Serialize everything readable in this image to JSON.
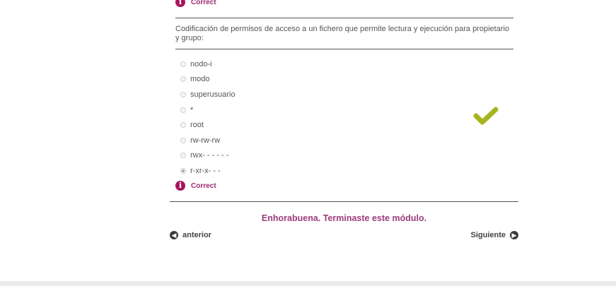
{
  "top_feedback": {
    "icon": "info-icon",
    "label": "Correct"
  },
  "question": {
    "text": "Codificación de permisos de acceso a un fichero que permite lectura y ejecución para propietario y grupo:",
    "options": [
      {
        "label": "nodo-i",
        "selected": false
      },
      {
        "label": "modo",
        "selected": false
      },
      {
        "label": "superusuario",
        "selected": false
      },
      {
        "label": "*",
        "selected": false
      },
      {
        "label": "root",
        "selected": false
      },
      {
        "label": "rw-rw-rw",
        "selected": false
      },
      {
        "label": "rwx- - - - - -",
        "selected": false
      },
      {
        "label": "r-xr-x- - -",
        "selected": true
      }
    ],
    "feedback": {
      "icon": "info-icon",
      "label": "Correct"
    },
    "status_icon": "check-icon"
  },
  "completion_message": "Enhorabuena. Terminaste este módulo.",
  "nav": {
    "prev_label": "anterior",
    "next_label": "Siguiente"
  },
  "colors": {
    "accent": "#9c3c7b",
    "info_icon": "#a8145e",
    "check": "#a6b51f"
  }
}
